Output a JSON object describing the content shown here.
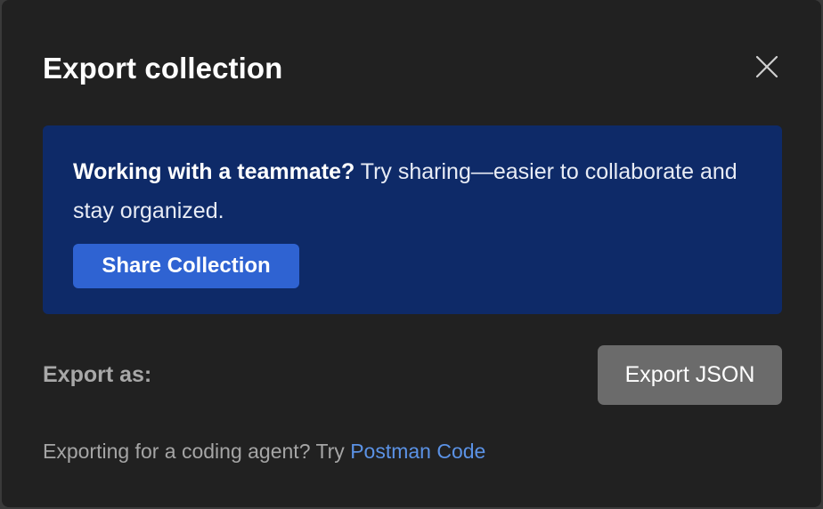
{
  "dialog": {
    "title": "Export collection",
    "close_icon": "close-icon"
  },
  "banner": {
    "heading": "Working with a teammate?",
    "body": " Try sharing—easier to collaborate and stay organized.",
    "button_label": "Share Collection",
    "background_color": "#0e2a68",
    "button_color": "#2f63d2"
  },
  "export": {
    "label": "Export as:",
    "button_label": "Export JSON"
  },
  "footer": {
    "text": "Exporting for a coding agent? Try ",
    "link_label": "Postman Code",
    "link_color": "#5b92e5"
  }
}
